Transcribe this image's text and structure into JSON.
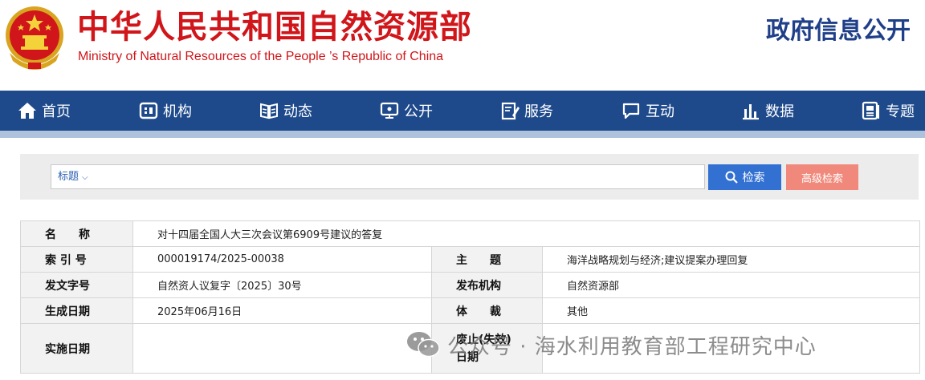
{
  "header": {
    "title_cn": "中华人民共和国自然资源部",
    "title_en": "Ministry of Natural Resources of the People ’s Republic of China",
    "gov_open": "政府信息公开"
  },
  "nav": {
    "items": [
      {
        "label": "首页",
        "icon": "home-icon"
      },
      {
        "label": "机构",
        "icon": "org-icon"
      },
      {
        "label": "动态",
        "icon": "book-icon"
      },
      {
        "label": "公开",
        "icon": "monitor-icon"
      },
      {
        "label": "服务",
        "icon": "edit-icon"
      },
      {
        "label": "互动",
        "icon": "chat-icon"
      },
      {
        "label": "数据",
        "icon": "chart-icon"
      },
      {
        "label": "专题",
        "icon": "doc-icon"
      }
    ]
  },
  "search": {
    "field_label": "标题",
    "value": "",
    "search_label": "检索",
    "advanced_label": "高级检索"
  },
  "info": {
    "name_label": "名　　称",
    "name_value": "对十四届全国人大三次会议第6909号建议的答复",
    "index_label": "索 引 号",
    "index_value": "000019174/2025-00038",
    "subject_label": "主　　题",
    "subject_value": "海洋战略规划与经济;建议提案办理回复",
    "doc_no_label": "发文字号",
    "doc_no_value": "自然资人议复字〔2025〕30号",
    "issuer_label": "发布机构",
    "issuer_value": "自然资源部",
    "date_label": "生成日期",
    "date_value": "2025年06月16日",
    "genre_label": "体　　裁",
    "genre_value": "其他",
    "effective_label": "实施日期",
    "effective_value": "",
    "repeal_label_1": "废止(失效)",
    "repeal_label_2": "日期",
    "repeal_value": ""
  },
  "watermark": {
    "text": "公众号 · 海水利用教育部工程研究中心"
  },
  "colors": {
    "brand_red": "#d0161a",
    "nav_blue": "#1e4a8c",
    "search_blue": "#3270d2",
    "advanced_salmon": "#f0897b",
    "title_navy": "#1f3f88"
  }
}
